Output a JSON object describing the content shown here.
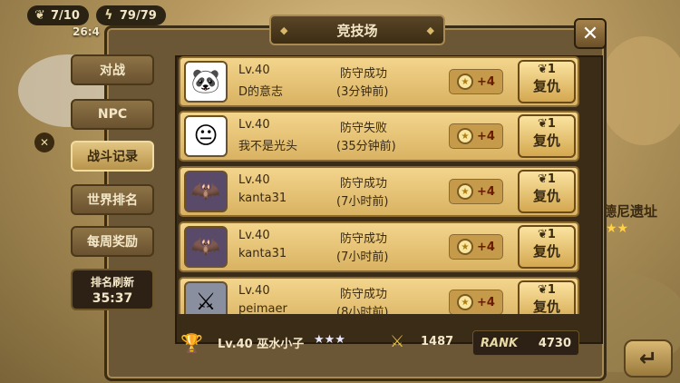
{
  "topbar": {
    "energy": "7/10",
    "energy_timer": "26:4",
    "stamina": "79/79"
  },
  "side": {
    "location_title": "德尼遗址",
    "stars": "★★"
  },
  "window": {
    "title": "竞技场",
    "close_label": "✕"
  },
  "tabs": [
    {
      "label": "对战",
      "active": false
    },
    {
      "label": "NPC",
      "active": false
    },
    {
      "label": "战斗记录",
      "active": true
    },
    {
      "label": "世界排名",
      "active": false
    },
    {
      "label": "每周奖励",
      "active": false
    }
  ],
  "refresh": {
    "label": "排名刷新",
    "time": "35:37"
  },
  "records": [
    {
      "level": "Lv.40",
      "name": "D的意志",
      "result": "防守成功",
      "ago": "(3分钟前)",
      "points": "+4",
      "cost": "1",
      "action": "复仇",
      "avatar": "panda-icon"
    },
    {
      "level": "Lv.40",
      "name": "我不是光头",
      "result": "防守失败",
      "ago": "(35分钟前)",
      "points": "+4",
      "cost": "1",
      "action": "复仇",
      "avatar": "face-icon"
    },
    {
      "level": "Lv.40",
      "name": "kanta31",
      "result": "防守成功",
      "ago": "(7小时前)",
      "points": "+4",
      "cost": "1",
      "action": "复仇",
      "avatar": "bat-icon"
    },
    {
      "level": "Lv.40",
      "name": "kanta31",
      "result": "防守成功",
      "ago": "(7小时前)",
      "points": "+4",
      "cost": "1",
      "action": "复仇",
      "avatar": "bat-icon"
    },
    {
      "level": "Lv.40",
      "name": "peimaer",
      "result": "防守成功",
      "ago": "(8小时前)",
      "points": "+4",
      "cost": "1",
      "action": "复仇",
      "avatar": "knight-icon"
    }
  ],
  "player": {
    "level_name": "Lv.40 巫水小子",
    "stars": "★★★",
    "power": "1487",
    "rank_label": "RANK",
    "rank_value": "4730"
  }
}
